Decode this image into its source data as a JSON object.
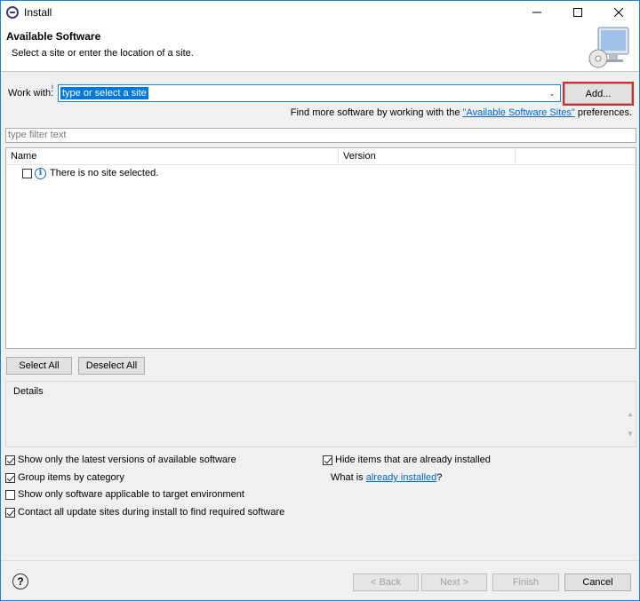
{
  "window": {
    "title": "Install"
  },
  "header": {
    "title": "Available Software",
    "subtitle": "Select a site or enter the location of a site."
  },
  "work_with": {
    "label": "Work with:",
    "combo_value": "type or select a site",
    "add_button": "Add..."
  },
  "find_more": {
    "prefix": "Find more software by working with the ",
    "link": "\"Available Software Sites\"",
    "suffix": " preferences."
  },
  "filter": {
    "placeholder": "type filter text"
  },
  "tree": {
    "columns": [
      "Name",
      "Version"
    ],
    "rows": [
      {
        "label": "There is no site selected.",
        "checked": false
      }
    ]
  },
  "selection_buttons": {
    "select_all": "Select All",
    "deselect_all": "Deselect All"
  },
  "details": {
    "label": "Details"
  },
  "options": {
    "latest_versions": {
      "label": "Show only the latest versions of available software",
      "checked": true
    },
    "group_by_category": {
      "label": "Group items by category",
      "checked": true
    },
    "applicable_only": {
      "label": "Show only software applicable to target environment",
      "checked": false
    },
    "contact_sites": {
      "label": "Contact all update sites during install to find required software",
      "checked": true
    },
    "hide_installed": {
      "label": "Hide items that are already installed",
      "checked": true
    },
    "what_is": {
      "prefix": "What is ",
      "link": "already installed",
      "suffix": "?"
    }
  },
  "footer": {
    "back": "< Back",
    "next": "Next >",
    "finish": "Finish",
    "cancel": "Cancel"
  }
}
